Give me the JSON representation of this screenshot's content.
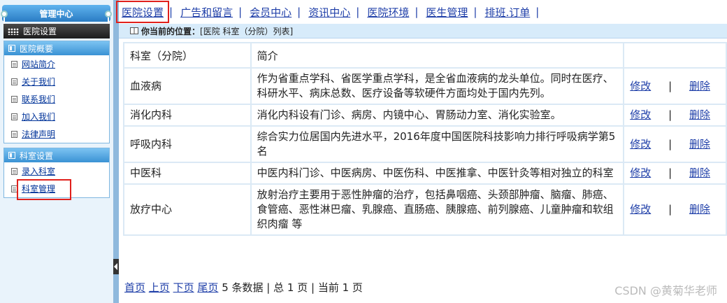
{
  "sidebar": {
    "header": "管理中心",
    "section": "医院设置",
    "panels": [
      {
        "title": "医院概要",
        "items": [
          "网站简介",
          "关于我们",
          "联系我们",
          "加入我们",
          "法律声明"
        ]
      },
      {
        "title": "科室设置",
        "items": [
          "录入科室",
          "科室管理"
        ]
      }
    ]
  },
  "topnav": {
    "items": [
      "医院设置",
      "广告和留言",
      "会员中心",
      "资讯中心",
      "医院环境",
      "医生管理",
      "排班.订单"
    ],
    "separator": "|"
  },
  "breadcrumb": {
    "label": "你当前的位置：",
    "path": "[医院 科室（分院）列表]"
  },
  "table": {
    "headers": [
      "科室（分院）",
      "简介",
      ""
    ],
    "edit_label": "修改",
    "delete_label": "删除",
    "op_separator": "|",
    "rows": [
      {
        "name": "血液病",
        "intro": "作为省重点学科、省医学重点学科，是全省血液病的龙头单位。同时在医疗、科研水平、病床总数、医疗设备等软硬件方面均处于国内先列。"
      },
      {
        "name": "消化内科",
        "intro": "消化内科设有门诊、病房、内镜中心、胃肠动力室、消化实验室。"
      },
      {
        "name": "呼吸内科",
        "intro": "综合实力位居国内先进水平，2016年度中国医院科技影响力排行呼吸病学第5名"
      },
      {
        "name": "中医科",
        "intro": "中医内科门诊、中医病房、中医伤科、中医推拿、中医针灸等相对独立的科室"
      },
      {
        "name": "放疗中心",
        "intro": "放射治疗主要用于恶性肿瘤的治疗，包括鼻咽癌、头颈部肿瘤、脑瘤、肺癌、食管癌、恶性淋巴瘤、乳腺癌、直肠癌、胰腺癌、前列腺癌、儿童肿瘤和软组织肉瘤 等"
      }
    ]
  },
  "pager": {
    "first": "首页",
    "prev": "上页",
    "next": "下页",
    "last": "尾页",
    "count_text": "5 条数据",
    "total_text": "总 1 页",
    "current_text": "当前 1 页",
    "separator": "|"
  },
  "watermark": "CSDN @黄菊华老师",
  "colors": {
    "highlight_border": "#e0201c",
    "link": "#1e3ea8",
    "panel_header": "#3a92d4"
  }
}
